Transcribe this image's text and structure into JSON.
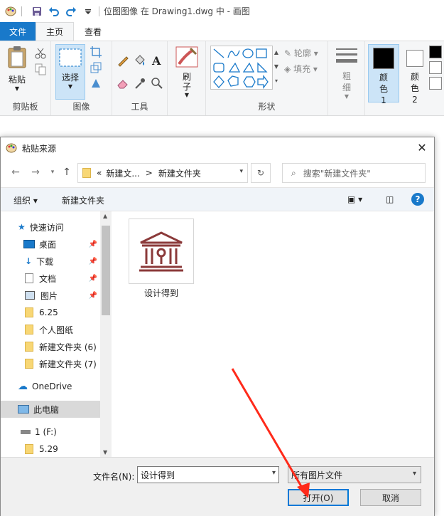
{
  "titlebar": {
    "title": "位图图像 在 Drawing1.dwg 中 - 画图",
    "quick_icons": [
      "paint-app-icon",
      "save-icon",
      "undo-icon",
      "redo-icon",
      "customize-icon"
    ]
  },
  "menu": {
    "file": "文件",
    "home": "主页",
    "view": "查看"
  },
  "ribbon": {
    "clipboard": {
      "label": "剪贴板",
      "paste": "粘贴"
    },
    "image": {
      "label": "图像",
      "select": "选择"
    },
    "tools": {
      "label": "工具"
    },
    "brush": {
      "label": "刷子"
    },
    "shapes": {
      "label": "形状",
      "outline": "轮廓",
      "fill": "填充"
    },
    "size": {
      "label": "粗细"
    },
    "color1": {
      "label": "颜色 1",
      "value": "#000000"
    },
    "color2": {
      "label": "颜色 2",
      "value": "#ffffff"
    }
  },
  "dialog": {
    "title": "粘贴来源",
    "address": {
      "prefix": "«",
      "segment1": "新建文...",
      "separator": ">",
      "segment2": "新建文件夹"
    },
    "search_placeholder": "搜索\"新建文件夹\"",
    "toolbar": {
      "organize": "组织",
      "new_folder": "新建文件夹"
    },
    "nav": [
      {
        "label": "快速访问",
        "icon": "star-icon"
      },
      {
        "label": "桌面",
        "icon": "desktop-icon",
        "pinned": true
      },
      {
        "label": "下载",
        "icon": "download-icon",
        "pinned": true
      },
      {
        "label": "文档",
        "icon": "document-icon",
        "pinned": true
      },
      {
        "label": "图片",
        "icon": "picture-icon",
        "pinned": true
      },
      {
        "label": "6.25",
        "icon": "folder-icon"
      },
      {
        "label": "个人图纸",
        "icon": "folder-icon"
      },
      {
        "label": "新建文件夹 (6)",
        "icon": "folder-icon"
      },
      {
        "label": "新建文件夹 (7)",
        "icon": "folder-icon"
      },
      {
        "label": "OneDrive",
        "icon": "cloud-icon"
      },
      {
        "label": "此电脑",
        "icon": "computer-icon"
      },
      {
        "label": "1 (F:)",
        "icon": "drive-icon"
      },
      {
        "label": "5.29",
        "icon": "folder-icon"
      }
    ],
    "files": [
      {
        "name": "设计得到",
        "icon": "building-icon"
      }
    ],
    "filename_label": "文件名(N):",
    "filename_value": "设计得到",
    "filetype_value": "所有图片文件",
    "open_button": "打开(O)",
    "cancel_button": "取消"
  },
  "accent_color": "#1979ca",
  "arrow_color": "#ff2a1a"
}
